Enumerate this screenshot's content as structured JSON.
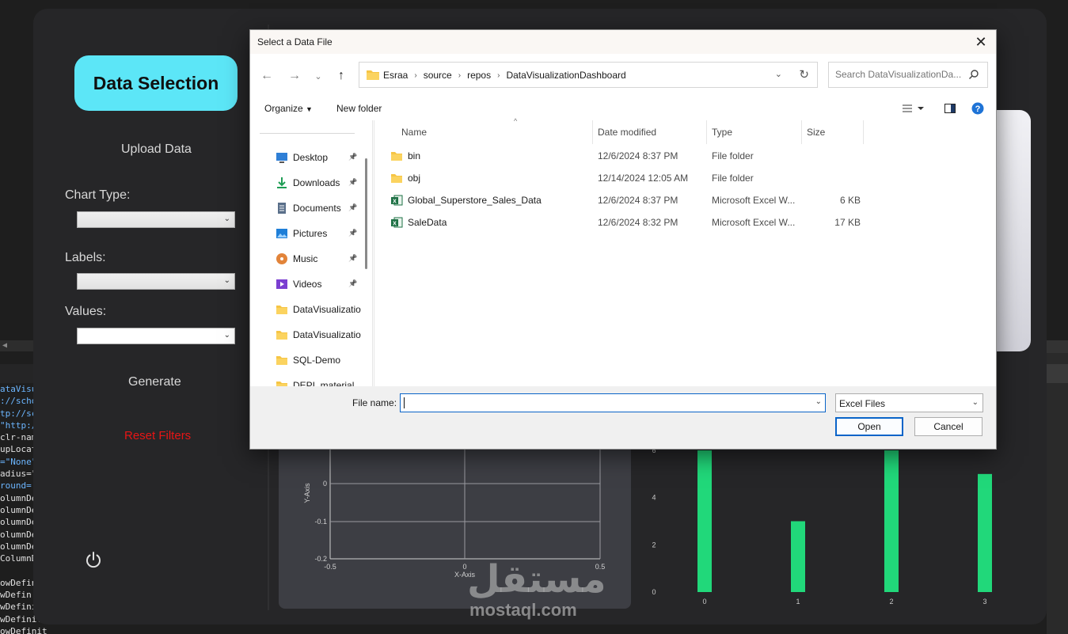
{
  "code_editor": {
    "scroll_arrow": "◀",
    "lines": [
      {
        "text": "ataVisua",
        "blue": true
      },
      {
        "text": "://scho",
        "blue": true
      },
      {
        "text": "tp://sc",
        "blue": true
      },
      {
        "text": "\"http:/",
        "blue": true
      },
      {
        "text": "clr-nam",
        "blue": false
      },
      {
        "text": "upLocat",
        "blue": false
      },
      {
        "text": "=\"None\"",
        "blue": true
      },
      {
        "text": "adius=\"",
        "blue": false
      },
      {
        "text": "round=",
        "blue": true
      },
      {
        "text": "olumnDe",
        "blue": false
      },
      {
        "text": "olumnDe",
        "blue": false
      },
      {
        "text": "olumnDe",
        "blue": false
      },
      {
        "text": "olumnDe",
        "blue": false
      },
      {
        "text": "olumnDe",
        "blue": false
      },
      {
        "text": "ColumnD",
        "blue": false
      },
      {
        "text": "",
        "blue": false
      },
      {
        "text": "owDefin",
        "blue": false
      },
      {
        "text": "wDefin:",
        "blue": false
      },
      {
        "text": "wDefini",
        "blue": false
      },
      {
        "text": "wDefinition Height=\"",
        "blue": false
      },
      {
        "text": "owDefinit",
        "blue": false
      }
    ]
  },
  "sidebar": {
    "title": "Data Selection",
    "upload_label": "Upload Data",
    "chart_type_label": "Chart Type:",
    "labels_label": "Labels:",
    "values_label": "Values:",
    "chart_type_value": "",
    "labels_value": "",
    "values_value": "",
    "generate_label": "Generate",
    "reset_label": "Reset Filters"
  },
  "line_chart": {
    "xlabel": "X-Axis",
    "ylabel": "Y-Axis",
    "x_ticks": [
      "-0.5",
      "0",
      "0.5"
    ],
    "y_ticks": [
      "0",
      "-0.1",
      "-0.2"
    ]
  },
  "chart_data": {
    "type": "bar",
    "categories": [
      "0",
      "1",
      "2",
      "3"
    ],
    "values": [
      6,
      3,
      6,
      5
    ],
    "ylim": [
      0,
      6
    ],
    "y_ticks": [
      "6",
      "4",
      "2",
      "0"
    ],
    "color": "#21d87a"
  },
  "dialog": {
    "title": "Select a Data File",
    "path": [
      "Esraa",
      "source",
      "repos",
      "DataVisualizationDashboard"
    ],
    "search_placeholder": "Search DataVisualizationDa...",
    "organize_label": "Organize",
    "new_folder_label": "New folder",
    "nav_items": [
      {
        "label": "Desktop",
        "icon": "desktop-icon",
        "pinned": true
      },
      {
        "label": "Downloads",
        "icon": "downloads-icon",
        "pinned": true
      },
      {
        "label": "Documents",
        "icon": "documents-icon",
        "pinned": true
      },
      {
        "label": "Pictures",
        "icon": "pictures-icon",
        "pinned": true
      },
      {
        "label": "Music",
        "icon": "music-icon",
        "pinned": true
      },
      {
        "label": "Videos",
        "icon": "videos-icon",
        "pinned": true
      },
      {
        "label": "DataVisualizatio",
        "icon": "folder-icon",
        "pinned": false
      },
      {
        "label": "DataVisualizatio",
        "icon": "folder-icon",
        "pinned": false
      },
      {
        "label": "SQL-Demo",
        "icon": "folder-icon",
        "pinned": false
      },
      {
        "label": "DEPI_material",
        "icon": "folder-icon",
        "pinned": false
      }
    ],
    "columns": {
      "name": "Name",
      "date": "Date modified",
      "type": "Type",
      "size": "Size"
    },
    "files": [
      {
        "name": "bin",
        "date": "12/6/2024 8:37 PM",
        "type": "File folder",
        "size": "",
        "icon": "folder-icon"
      },
      {
        "name": "obj",
        "date": "12/14/2024 12:05 AM",
        "type": "File folder",
        "size": "",
        "icon": "folder-icon"
      },
      {
        "name": "Global_Superstore_Sales_Data",
        "date": "12/6/2024 8:37 PM",
        "type": "Microsoft Excel W...",
        "size": "6 KB",
        "icon": "excel-icon"
      },
      {
        "name": "SaleData",
        "date": "12/6/2024 8:32 PM",
        "type": "Microsoft Excel W...",
        "size": "17 KB",
        "icon": "excel-icon"
      }
    ],
    "file_name_label": "File name:",
    "file_name_value": "",
    "file_type_value": "Excel Files",
    "open_label": "Open",
    "cancel_label": "Cancel"
  },
  "watermark": {
    "arabic": "مستقل",
    "latin": "mostaql.com"
  },
  "colors": {
    "accent_cyan": "#5ce6f7",
    "reset_red": "#e81515",
    "bar_green": "#21d87a",
    "dialog_blue": "#0a64c8"
  }
}
